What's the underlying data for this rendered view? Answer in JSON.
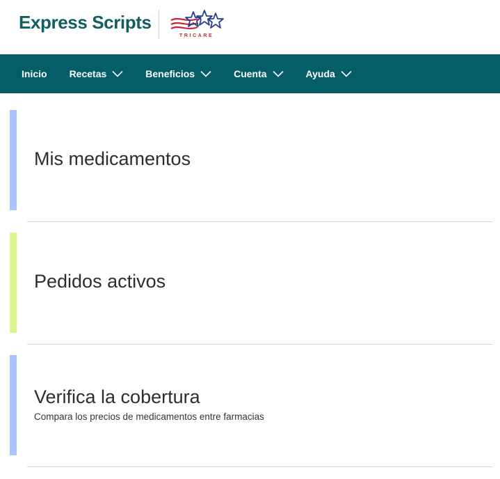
{
  "header": {
    "brand": "Express Scripts",
    "partner_logo_text": "TRICARE",
    "colors": {
      "brand": "#0f5f62",
      "nav_bg": "#045e68"
    }
  },
  "nav": {
    "items": [
      {
        "label": "Inicio",
        "dropdown": false
      },
      {
        "label": "Recetas",
        "dropdown": true
      },
      {
        "label": "Beneficios",
        "dropdown": true
      },
      {
        "label": "Cuenta",
        "dropdown": true
      },
      {
        "label": "Ayuda",
        "dropdown": true
      }
    ]
  },
  "cards": [
    {
      "title": "Mis medicamentos",
      "accent": "#a9c4ff"
    },
    {
      "title": "Pedidos activos",
      "accent": "#dcf58c"
    },
    {
      "title": "Verifica la cobertura",
      "subtitle": "Compara los precios de medicamentos entre farmacias",
      "accent": "#a9c4ff"
    }
  ]
}
